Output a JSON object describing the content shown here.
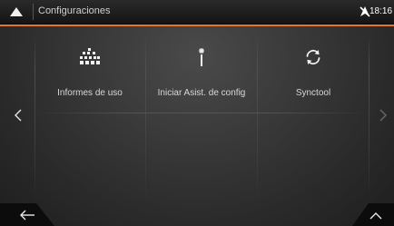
{
  "header": {
    "title": "Configuraciones",
    "time": "18:16",
    "icons": {
      "menu": "menu-triangle-icon",
      "gps": "gps-off-icon"
    }
  },
  "tiles": [
    {
      "label": "Informes de uso",
      "icon": "usage-dots-icon"
    },
    {
      "label": "Iniciar Asist. de config",
      "icon": "magic-wand-icon"
    },
    {
      "label": "Synctool",
      "icon": "sync-icon"
    }
  ],
  "navigation": {
    "prev_icon": "chevron-left-icon",
    "next_icon": "chevron-right-icon",
    "back_icon": "back-arrow-icon",
    "up_icon": "chevron-up-icon"
  },
  "colors": {
    "accent": "#e8742c",
    "background": "#3a3a3a",
    "text": "#d8d8d8"
  }
}
